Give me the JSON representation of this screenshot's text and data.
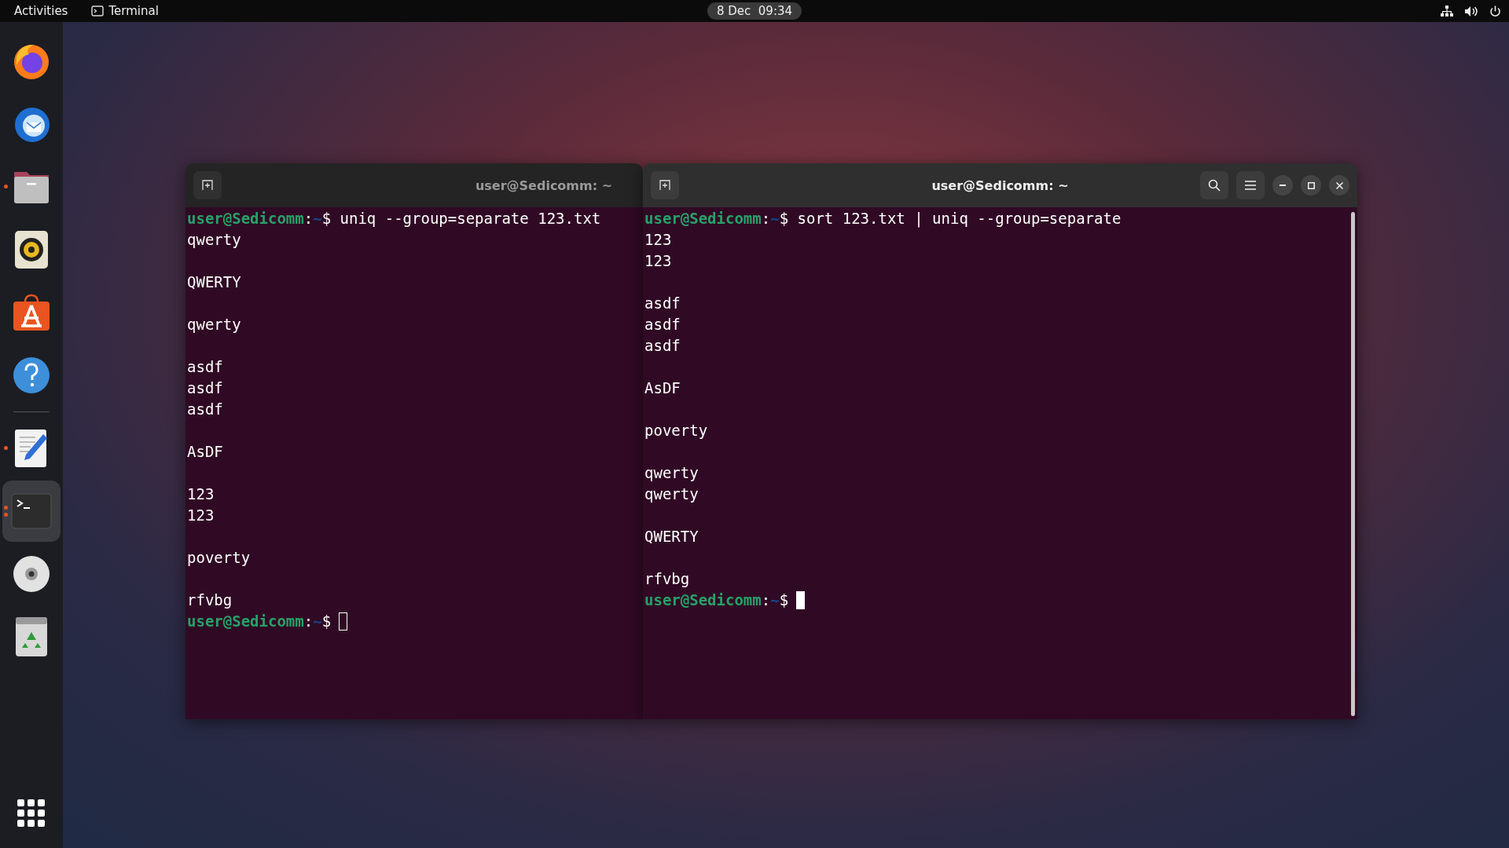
{
  "top_bar": {
    "activities": "Activities",
    "app_name": "Terminal",
    "clock": "8 Dec  09:34"
  },
  "dock": {
    "items": [
      {
        "kind": "firefox",
        "running": false,
        "focused": false
      },
      {
        "kind": "mail",
        "running": false,
        "focused": false
      },
      {
        "kind": "files",
        "running": true,
        "focused": false
      },
      {
        "kind": "speaker",
        "running": false,
        "focused": false
      },
      {
        "kind": "store",
        "running": false,
        "focused": false
      },
      {
        "kind": "help",
        "running": false,
        "focused": false
      },
      {
        "kind": "separator",
        "running": false,
        "focused": false
      },
      {
        "kind": "editor",
        "running": true,
        "focused": false
      },
      {
        "kind": "terminal",
        "running": true,
        "focused": true
      },
      {
        "kind": "disc",
        "running": false,
        "focused": false
      },
      {
        "kind": "trash",
        "running": false,
        "focused": false
      }
    ]
  },
  "windows": [
    {
      "title": "user@Sedicomm: ~",
      "focused": false,
      "controls_visible": false,
      "lines": [
        {
          "kind": "prompt",
          "user_host": "user@Sedicomm",
          "separator": ":",
          "path": "~",
          "symbol": "$",
          "command": "uniq --group=separate 123.txt"
        },
        {
          "kind": "output",
          "text": "qwerty"
        },
        {
          "kind": "blank"
        },
        {
          "kind": "output",
          "text": "QWERTY"
        },
        {
          "kind": "blank"
        },
        {
          "kind": "output",
          "text": "qwerty"
        },
        {
          "kind": "blank"
        },
        {
          "kind": "output",
          "text": "asdf"
        },
        {
          "kind": "output",
          "text": "asdf"
        },
        {
          "kind": "output",
          "text": "asdf"
        },
        {
          "kind": "blank"
        },
        {
          "kind": "output",
          "text": "AsDF"
        },
        {
          "kind": "blank"
        },
        {
          "kind": "output",
          "text": "123"
        },
        {
          "kind": "output",
          "text": "123"
        },
        {
          "kind": "blank"
        },
        {
          "kind": "output",
          "text": "poverty"
        },
        {
          "kind": "blank"
        },
        {
          "kind": "output",
          "text": "rfvbg"
        },
        {
          "kind": "prompt",
          "user_host": "user@Sedicomm",
          "separator": ":",
          "path": "~",
          "symbol": "$",
          "cursor": true
        }
      ]
    },
    {
      "title": "user@Sedicomm: ~",
      "focused": true,
      "controls_visible": true,
      "lines": [
        {
          "kind": "prompt",
          "user_host": "user@Sedicomm",
          "separator": ":",
          "path": "~",
          "symbol": "$",
          "command": "sort 123.txt | uniq --group=separate"
        },
        {
          "kind": "output",
          "text": "123"
        },
        {
          "kind": "output",
          "text": "123"
        },
        {
          "kind": "blank"
        },
        {
          "kind": "output",
          "text": "asdf"
        },
        {
          "kind": "output",
          "text": "asdf"
        },
        {
          "kind": "output",
          "text": "asdf"
        },
        {
          "kind": "blank"
        },
        {
          "kind": "output",
          "text": "AsDF"
        },
        {
          "kind": "blank"
        },
        {
          "kind": "output",
          "text": "poverty"
        },
        {
          "kind": "blank"
        },
        {
          "kind": "output",
          "text": "qwerty"
        },
        {
          "kind": "output",
          "text": "qwerty"
        },
        {
          "kind": "blank"
        },
        {
          "kind": "output",
          "text": "QWERTY"
        },
        {
          "kind": "blank"
        },
        {
          "kind": "output",
          "text": "rfvbg"
        },
        {
          "kind": "prompt",
          "user_host": "user@Sedicomm",
          "separator": ":",
          "path": "~",
          "symbol": "$",
          "cursor": true
        }
      ]
    }
  ]
}
